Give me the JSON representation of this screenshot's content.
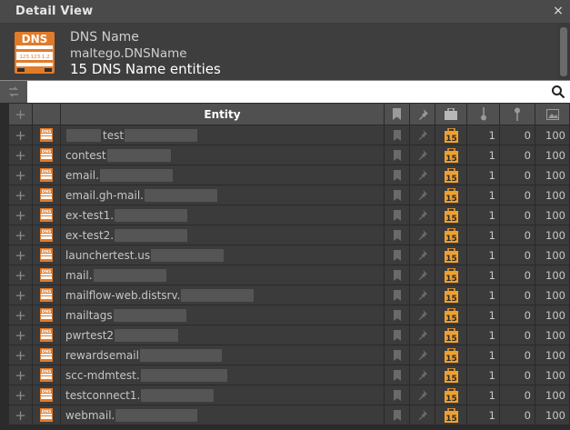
{
  "window": {
    "title": "Detail View",
    "close_glyph": "×"
  },
  "header": {
    "icon_label": "DNS",
    "icon_sub": "123.123.1.2",
    "line1": "DNS Name",
    "line2": "maltego.DNSName",
    "line3": "15 DNS Name entities"
  },
  "search": {
    "value": "",
    "placeholder": ""
  },
  "table": {
    "header": {
      "entity": "Entity"
    },
    "rows": [
      {
        "prefix": "",
        "name": "test",
        "blur": 80,
        "pre_blur": 38,
        "weight": "15",
        "incoming": "1",
        "outgoing": "0",
        "bookmark": "100"
      },
      {
        "prefix": "",
        "name": "contest",
        "blur": 70,
        "weight": "15",
        "incoming": "1",
        "outgoing": "0",
        "bookmark": "100"
      },
      {
        "prefix": "",
        "name": "email.",
        "blur": 80,
        "weight": "15",
        "incoming": "1",
        "outgoing": "0",
        "bookmark": "100"
      },
      {
        "prefix": "",
        "name": "email.gh-mail.",
        "blur": 80,
        "weight": "15",
        "incoming": "1",
        "outgoing": "0",
        "bookmark": "100"
      },
      {
        "prefix": "",
        "name": "ex-test1.",
        "blur": 80,
        "weight": "15",
        "incoming": "1",
        "outgoing": "0",
        "bookmark": "100"
      },
      {
        "prefix": "",
        "name": "ex-test2.",
        "blur": 80,
        "weight": "15",
        "incoming": "1",
        "outgoing": "0",
        "bookmark": "100"
      },
      {
        "prefix": "",
        "name": "launchertest.us",
        "blur": 80,
        "weight": "15",
        "incoming": "1",
        "outgoing": "0",
        "bookmark": "100"
      },
      {
        "prefix": "",
        "name": "mail.",
        "blur": 80,
        "weight": "15",
        "incoming": "1",
        "outgoing": "0",
        "bookmark": "100"
      },
      {
        "prefix": "",
        "name": "mailflow-web.distsrv.",
        "blur": 80,
        "weight": "15",
        "incoming": "1",
        "outgoing": "0",
        "bookmark": "100"
      },
      {
        "prefix": "",
        "name": "mailtags",
        "blur": 80,
        "weight": "15",
        "incoming": "1",
        "outgoing": "0",
        "bookmark": "100"
      },
      {
        "prefix": "",
        "name": "pwrtest2",
        "blur": 70,
        "weight": "15",
        "incoming": "1",
        "outgoing": "0",
        "bookmark": "100"
      },
      {
        "prefix": "",
        "name": "rewardsemail",
        "blur": 90,
        "weight": "15",
        "incoming": "1",
        "outgoing": "0",
        "bookmark": "100"
      },
      {
        "prefix": "",
        "name": "scc-mdmtest.",
        "blur": 95,
        "weight": "15",
        "incoming": "1",
        "outgoing": "0",
        "bookmark": "100"
      },
      {
        "prefix": "",
        "name": "testconnect1.",
        "blur": 80,
        "weight": "15",
        "incoming": "1",
        "outgoing": "0",
        "bookmark": "100"
      },
      {
        "prefix": "",
        "name": "webmail.",
        "blur": 90,
        "weight": "15",
        "incoming": "1",
        "outgoing": "0",
        "bookmark": "100"
      }
    ]
  },
  "colors": {
    "accent_orange": "#e07b2a",
    "row_bg": "#3b3b3b",
    "header_bg": "#505050",
    "weight_badge": "#f0a030"
  },
  "icons": [
    "close-icon",
    "dns-entity-icon",
    "link-toggle-icon",
    "search-icon",
    "plus-icon",
    "bookmark-icon",
    "pin-icon",
    "briefcase-icon",
    "incoming-icon",
    "outgoing-icon",
    "image-icon",
    "weight-badge-icon"
  ]
}
